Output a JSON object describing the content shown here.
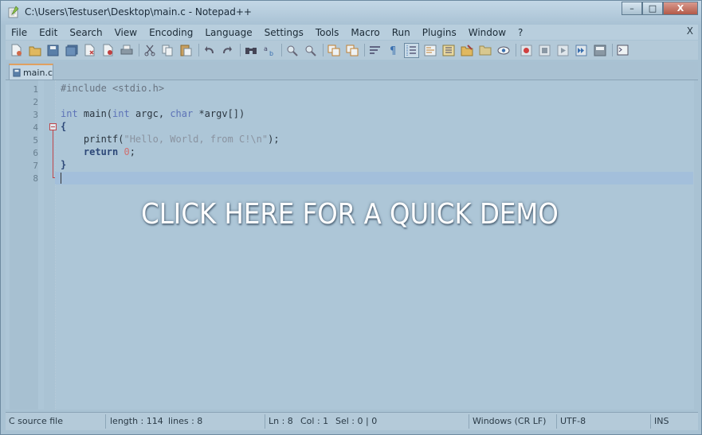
{
  "window": {
    "title": "C:\\Users\\Testuser\\Desktop\\main.c - Notepad++",
    "minimize_label": "–",
    "maximize_label": "□",
    "close_label": "X"
  },
  "menu": {
    "items": [
      "File",
      "Edit",
      "Search",
      "View",
      "Encoding",
      "Language",
      "Settings",
      "Tools",
      "Macro",
      "Run",
      "Plugins",
      "Window",
      "?"
    ],
    "close_doc_label": "X"
  },
  "toolbar": {
    "icons": [
      "new-file-icon",
      "open-file-icon",
      "save-icon",
      "save-all-icon",
      "close-icon",
      "close-all-icon",
      "print-icon",
      "cut-icon",
      "copy-icon",
      "paste-icon",
      "undo-icon",
      "redo-icon",
      "find-icon",
      "replace-icon",
      "zoom-in-icon",
      "zoom-out-icon",
      "sync-vertical-icon",
      "sync-horizontal-icon",
      "word-wrap-icon",
      "show-all-chars-icon",
      "indent-guide-icon",
      "document-map-icon",
      "function-list-icon",
      "folder-workspace-icon",
      "monitor-icon",
      "record-macro-icon",
      "stop-macro-icon",
      "play-macro-icon",
      "run-macro-multiple-icon",
      "save-macro-icon",
      "console-icon"
    ]
  },
  "tab": {
    "label": "main.c"
  },
  "editor": {
    "line_numbers": [
      "1",
      "2",
      "3",
      "4",
      "5",
      "6",
      "7",
      "8"
    ],
    "lines": {
      "l1": "#include <stdio.h>",
      "l3_kw1": "int",
      "l3_a": " main(",
      "l3_kw2": "int",
      "l3_b": " argc, ",
      "l3_kw3": "char",
      "l3_c": " *argv[])",
      "l4": "{",
      "l5_a": "    printf(",
      "l5_str": "\"Hello, World, from C!\\n\"",
      "l5_b": ");",
      "l6_kw": "return",
      "l6_num": "0",
      "l6_b": ";",
      "l7": "}"
    }
  },
  "overlay": {
    "text": "CLICK HERE FOR A QUICK DEMO"
  },
  "statusbar": {
    "file_type": "C source file",
    "length": "length : 114",
    "lines": "lines : 8",
    "ln": "Ln : 8",
    "col": "Col : 1",
    "sel": "Sel : 0 | 0",
    "eol": "Windows (CR LF)",
    "encoding": "UTF-8",
    "mode": "INS"
  }
}
